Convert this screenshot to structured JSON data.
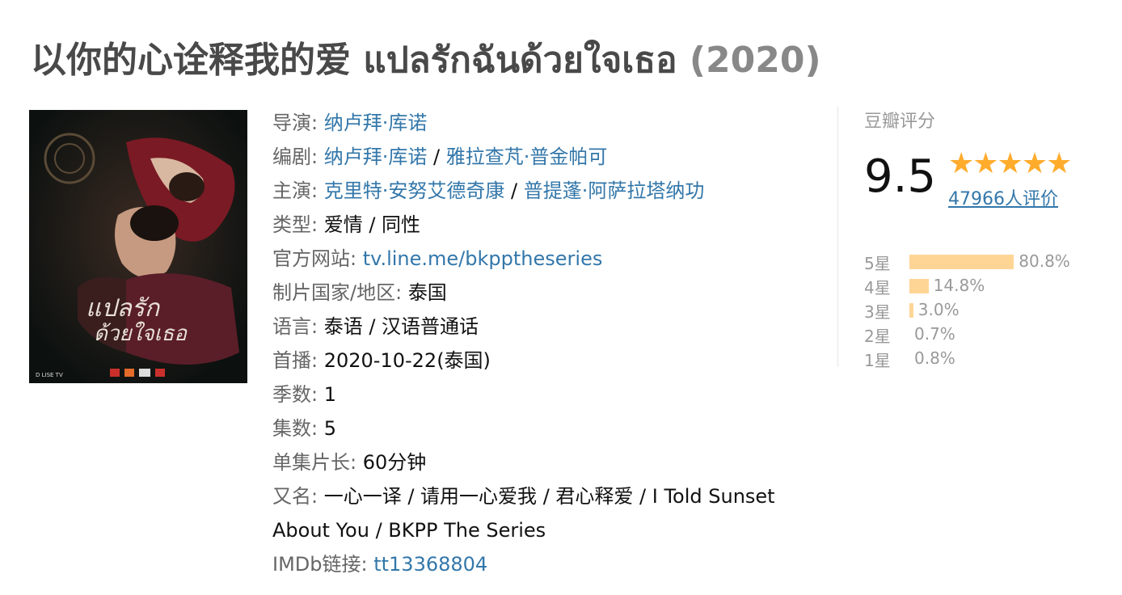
{
  "title": {
    "cn": "以你的心诠释我的爱",
    "th": "แปลรักฉันด้วยใจเธอ",
    "year": "(2020)"
  },
  "poster": {
    "alt_icon": "poster-image",
    "brand": "D LISE TV"
  },
  "info": {
    "director": {
      "label": "导演",
      "names": [
        "纳卢拜·库诺"
      ]
    },
    "writer": {
      "label": "编剧",
      "names": [
        "纳卢拜·库诺",
        "雅拉查芃·普金帕可"
      ]
    },
    "cast": {
      "label": "主演",
      "names": [
        "克里特·安努艾德奇康",
        "普提蓬·阿萨拉塔纳功"
      ]
    },
    "genre": {
      "label": "类型",
      "value": "爱情 / 同性"
    },
    "website": {
      "label": "官方网站",
      "value": "tv.line.me/bkpptheseries"
    },
    "country": {
      "label": "制片国家/地区",
      "value": "泰国"
    },
    "language": {
      "label": "语言",
      "value": "泰语 / 汉语普通话"
    },
    "premiere": {
      "label": "首播",
      "value": "2020-10-22(泰国)"
    },
    "season": {
      "label": "季数",
      "value": "1"
    },
    "episodes": {
      "label": "集数",
      "value": "5"
    },
    "runtime": {
      "label": "单集片长",
      "value": "60分钟"
    },
    "aka": {
      "label": "又名",
      "line1": "一心一译 / 请用一心爱我 / 君心释爱 / I Told Sunset",
      "line2": "About You / BKPP The Series"
    },
    "imdb": {
      "label": "IMDb链接",
      "value": "tt13368804"
    }
  },
  "rating": {
    "label": "豆瓣评分",
    "score": "9.5",
    "stars": "★★★★★",
    "votes": "47966人评价",
    "star_color": "#ffac2d",
    "bar_color": "#ffd596",
    "distribution": [
      {
        "label": "5星",
        "percent": 80.8,
        "text": "80.8%"
      },
      {
        "label": "4星",
        "percent": 14.8,
        "text": "14.8%"
      },
      {
        "label": "3星",
        "percent": 3.0,
        "text": "3.0%"
      },
      {
        "label": "2星",
        "percent": 0.7,
        "text": "0.7%"
      },
      {
        "label": "1星",
        "percent": 0.8,
        "text": "0.8%"
      }
    ]
  }
}
